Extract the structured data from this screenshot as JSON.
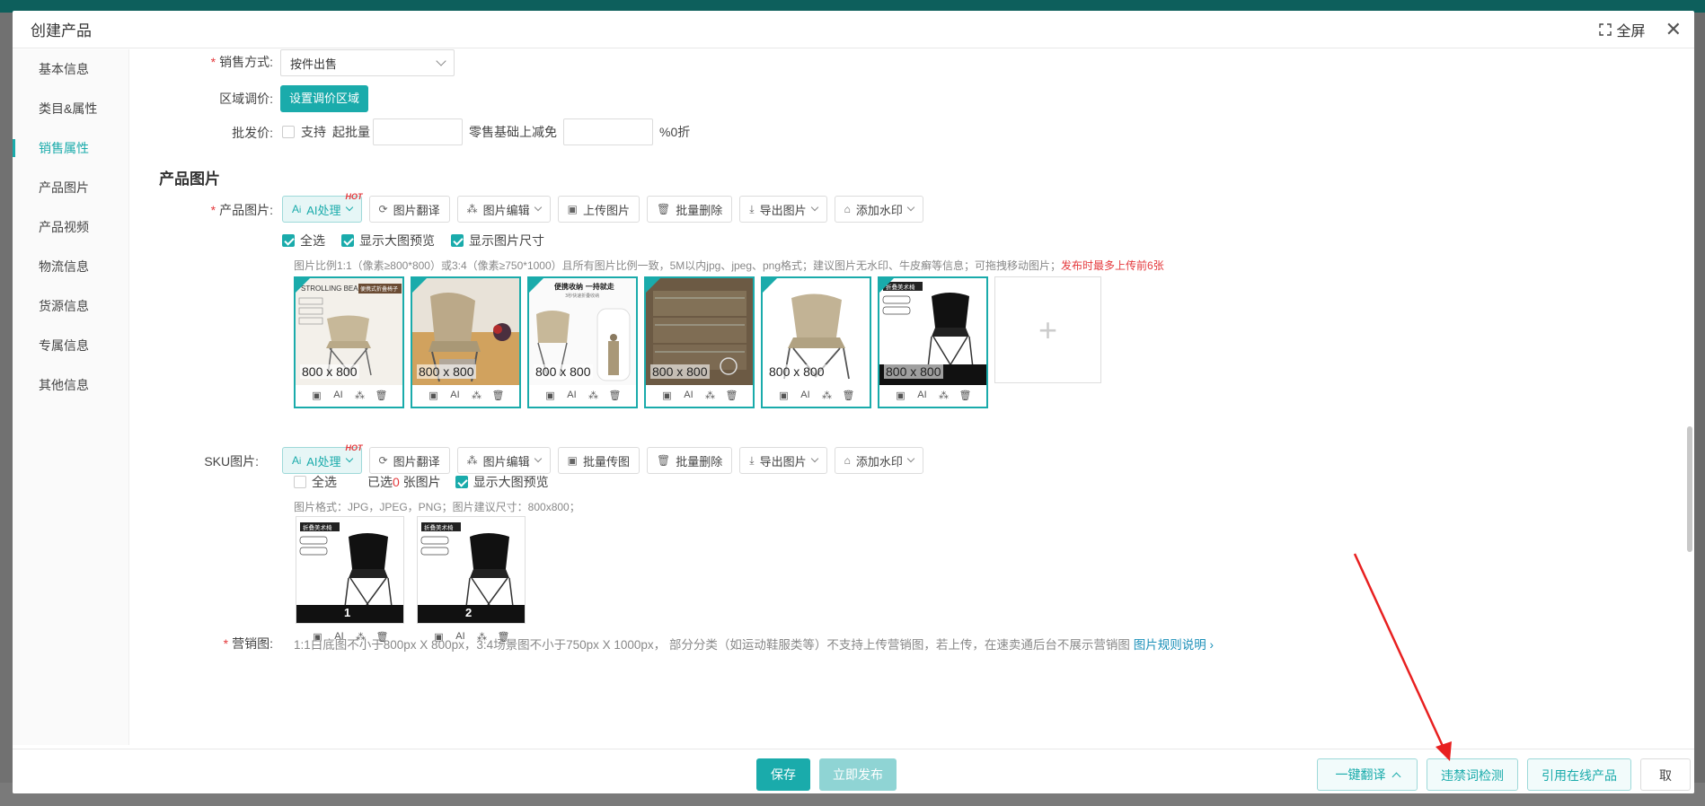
{
  "modal": {
    "title": "创建产品",
    "fullscreen_label": "全屏"
  },
  "sidebar": {
    "items": [
      {
        "label": "基本信息"
      },
      {
        "label": "类目&属性"
      },
      {
        "label": "销售属性"
      },
      {
        "label": "产品图片"
      },
      {
        "label": "产品视频"
      },
      {
        "label": "物流信息"
      },
      {
        "label": "货源信息"
      },
      {
        "label": "专属信息"
      },
      {
        "label": "其他信息"
      }
    ],
    "active": "销售属性"
  },
  "sales": {
    "method_label": "销售方式:",
    "method_value": "按件出售",
    "region_label": "区域调价:",
    "region_button": "设置调价区域",
    "wholesale_label": "批发价:",
    "wholesale_support": "支持",
    "wholesale_min": "起批量",
    "wholesale_discount": "零售基础上减免",
    "wholesale_unit": "%0折"
  },
  "product_images": {
    "section_title": "产品图片",
    "label": "产品图片:",
    "toolbar": {
      "ai": "AI处理",
      "hot": "HOT",
      "translate": "图片翻译",
      "edit": "图片编辑",
      "upload": "上传图片",
      "batch_delete": "批量删除",
      "export": "导出图片",
      "watermark": "添加水印"
    },
    "select_all": "全选",
    "show_preview": "显示大图预览",
    "show_size": "显示图片尺寸",
    "hint": "图片比例1:1（像素≥800*800）或3:4（像素≥750*1000）且所有图片比例一致，5M以内jpg、jpeg、png格式；建议图片无水印、牛皮癣等信息；可拖拽移动图片；",
    "hint_red": "发布时最多上传前6张",
    "images": [
      {
        "size": "800 x 800",
        "banner": "STROLLING BEARS",
        "tag": "便携式折叠椅子"
      },
      {
        "size": "800 x 800"
      },
      {
        "size": "800 x 800",
        "banner": "便携收纳 一持就走",
        "sub": "3秒快速折叠收纳"
      },
      {
        "size": "800 x 800"
      },
      {
        "size": "800 x 800"
      },
      {
        "size": "800 x 800",
        "banner": "折叠美术椅"
      }
    ]
  },
  "sku_images": {
    "label": "SKU图片:",
    "toolbar": {
      "ai": "AI处理",
      "hot": "HOT",
      "translate": "图片翻译",
      "edit": "图片编辑",
      "batch_upload": "批量传图",
      "batch_delete": "批量删除",
      "export": "导出图片",
      "watermark": "添加水印"
    },
    "select_all": "全选",
    "selected_prefix": "已选",
    "selected_count": "0",
    "selected_suffix": "张图片",
    "show_preview": "显示大图预览",
    "hint": "图片格式：JPG，JPEG，PNG；图片建议尺寸：800x800；",
    "images": [
      {
        "num": "1",
        "banner": "折叠美术椅"
      },
      {
        "num": "2",
        "banner": "折叠美术椅"
      }
    ]
  },
  "marketing": {
    "label": "营销图:",
    "text": "1:1白底图不小于800px X 800px，3:4场景图不小于750px X 1000px， 部分分类（如运动鞋服类等）不支持上传营销图，若上传，在速卖通后台不展示营销图",
    "link": "图片规则说明"
  },
  "footer": {
    "save": "保存",
    "publish": "立即发布",
    "translate": "一键翻译",
    "check_words": "违禁词检测",
    "cite": "引用在线产品",
    "cancel": "取消"
  },
  "colors": {
    "accent": "#1aabab",
    "danger": "#e4393c",
    "link": "#1a8fb8"
  }
}
